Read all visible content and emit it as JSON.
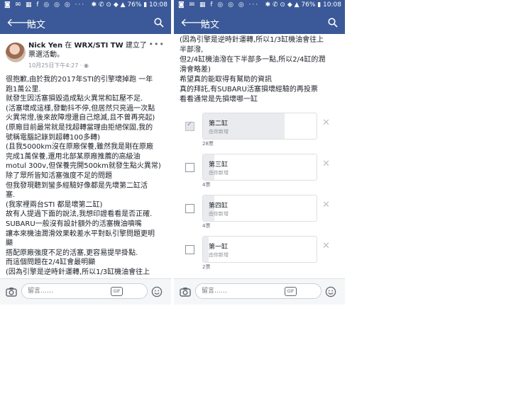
{
  "status_bar": {
    "left_icons": "◙ ✉ ▦ f ◎ ◎ ◎ ···",
    "right_text": "✱ ✆ ⊙ ◆ ▲ 76% ▮ 10:08"
  },
  "app_bar": {
    "title": "貼文"
  },
  "post": {
    "author": "Nick Yen",
    "action_pre": "在",
    "group": "WRX/STI TW",
    "action_post": "建立了票選活動。",
    "timestamp": "10月25日下午4:27 · ",
    "body_lines": [
      "很抱歉,由於我的2017年STI的引擎壞掉跑 一年",
      "跑1萬公里.",
      "就發生因活塞損毀造成點火異常和缸壓不足.",
      "(活塞壞成這樣,發動抖不停,但居然只亮過一次點",
      "火異常燈,後來故障燈還自己熄滅,且不曾再亮起)",
      "(原廠目前最常就是找超轉當理由拒絕保固,我的",
      "號稱電腦記錄到超轉100多轉)",
      "(且我5000km沒在原廠保養,雖然我是剛在原廠",
      "完成1萬保養,還用北部某原廠推薦的高級油",
      "motul 300v,但保養完開500km就發生點火異常)",
      "除了眾所皆知活塞強度不足的問題",
      "但我發現聽到蠻多經驗好像都是先壞第二缸活",
      "塞.",
      "(我家裡兩台STI 都是壞第二缸)",
      "故有人提過下面的說法,我想印證看看是否正確.",
      "SUBARU一般沒有設計額外的活塞機油噴嘴",
      "讓本來機油潤滑效果較差水平對臥引擎問題更明",
      "顯",
      "搭配原廠強度不足的活塞,更容易提早掛點.",
      "而這個問題在2/4缸會最明顯",
      "(因為引擎是逆時針運轉,所以1/3缸機油會往上"
    ],
    "continued_lines": [
      "(因為引擎是逆時針運轉,所以1/3缸機油會往上",
      "半部潑,",
      "但2/4缸機油潑在下半部多一點,所以2/4缸的潤",
      "滑會略差)",
      "希望真的能取得有幫助的資訊",
      "真的拜託,有SUBARU活塞損壞經驗的再投票",
      "看看通常是先損壞哪一缸"
    ]
  },
  "poll": {
    "options": [
      {
        "label": "第二缸",
        "sub": "由你新增",
        "votes": "28票",
        "checked": true,
        "fill": 0.72
      },
      {
        "label": "第三缸",
        "sub": "由你新增",
        "votes": "4票",
        "checked": false,
        "fill": 0.1
      },
      {
        "label": "第四缸",
        "sub": "由你新增",
        "votes": "4票",
        "checked": false,
        "fill": 0.1
      },
      {
        "label": "第一缸",
        "sub": "由你新增",
        "votes": "2票",
        "checked": false,
        "fill": 0.05
      }
    ]
  },
  "comment_bar": {
    "placeholder": "留言……",
    "gif_label": "GIF"
  },
  "colors": {
    "brand": "#3b5998",
    "poll_fill": "#e9ebee"
  }
}
